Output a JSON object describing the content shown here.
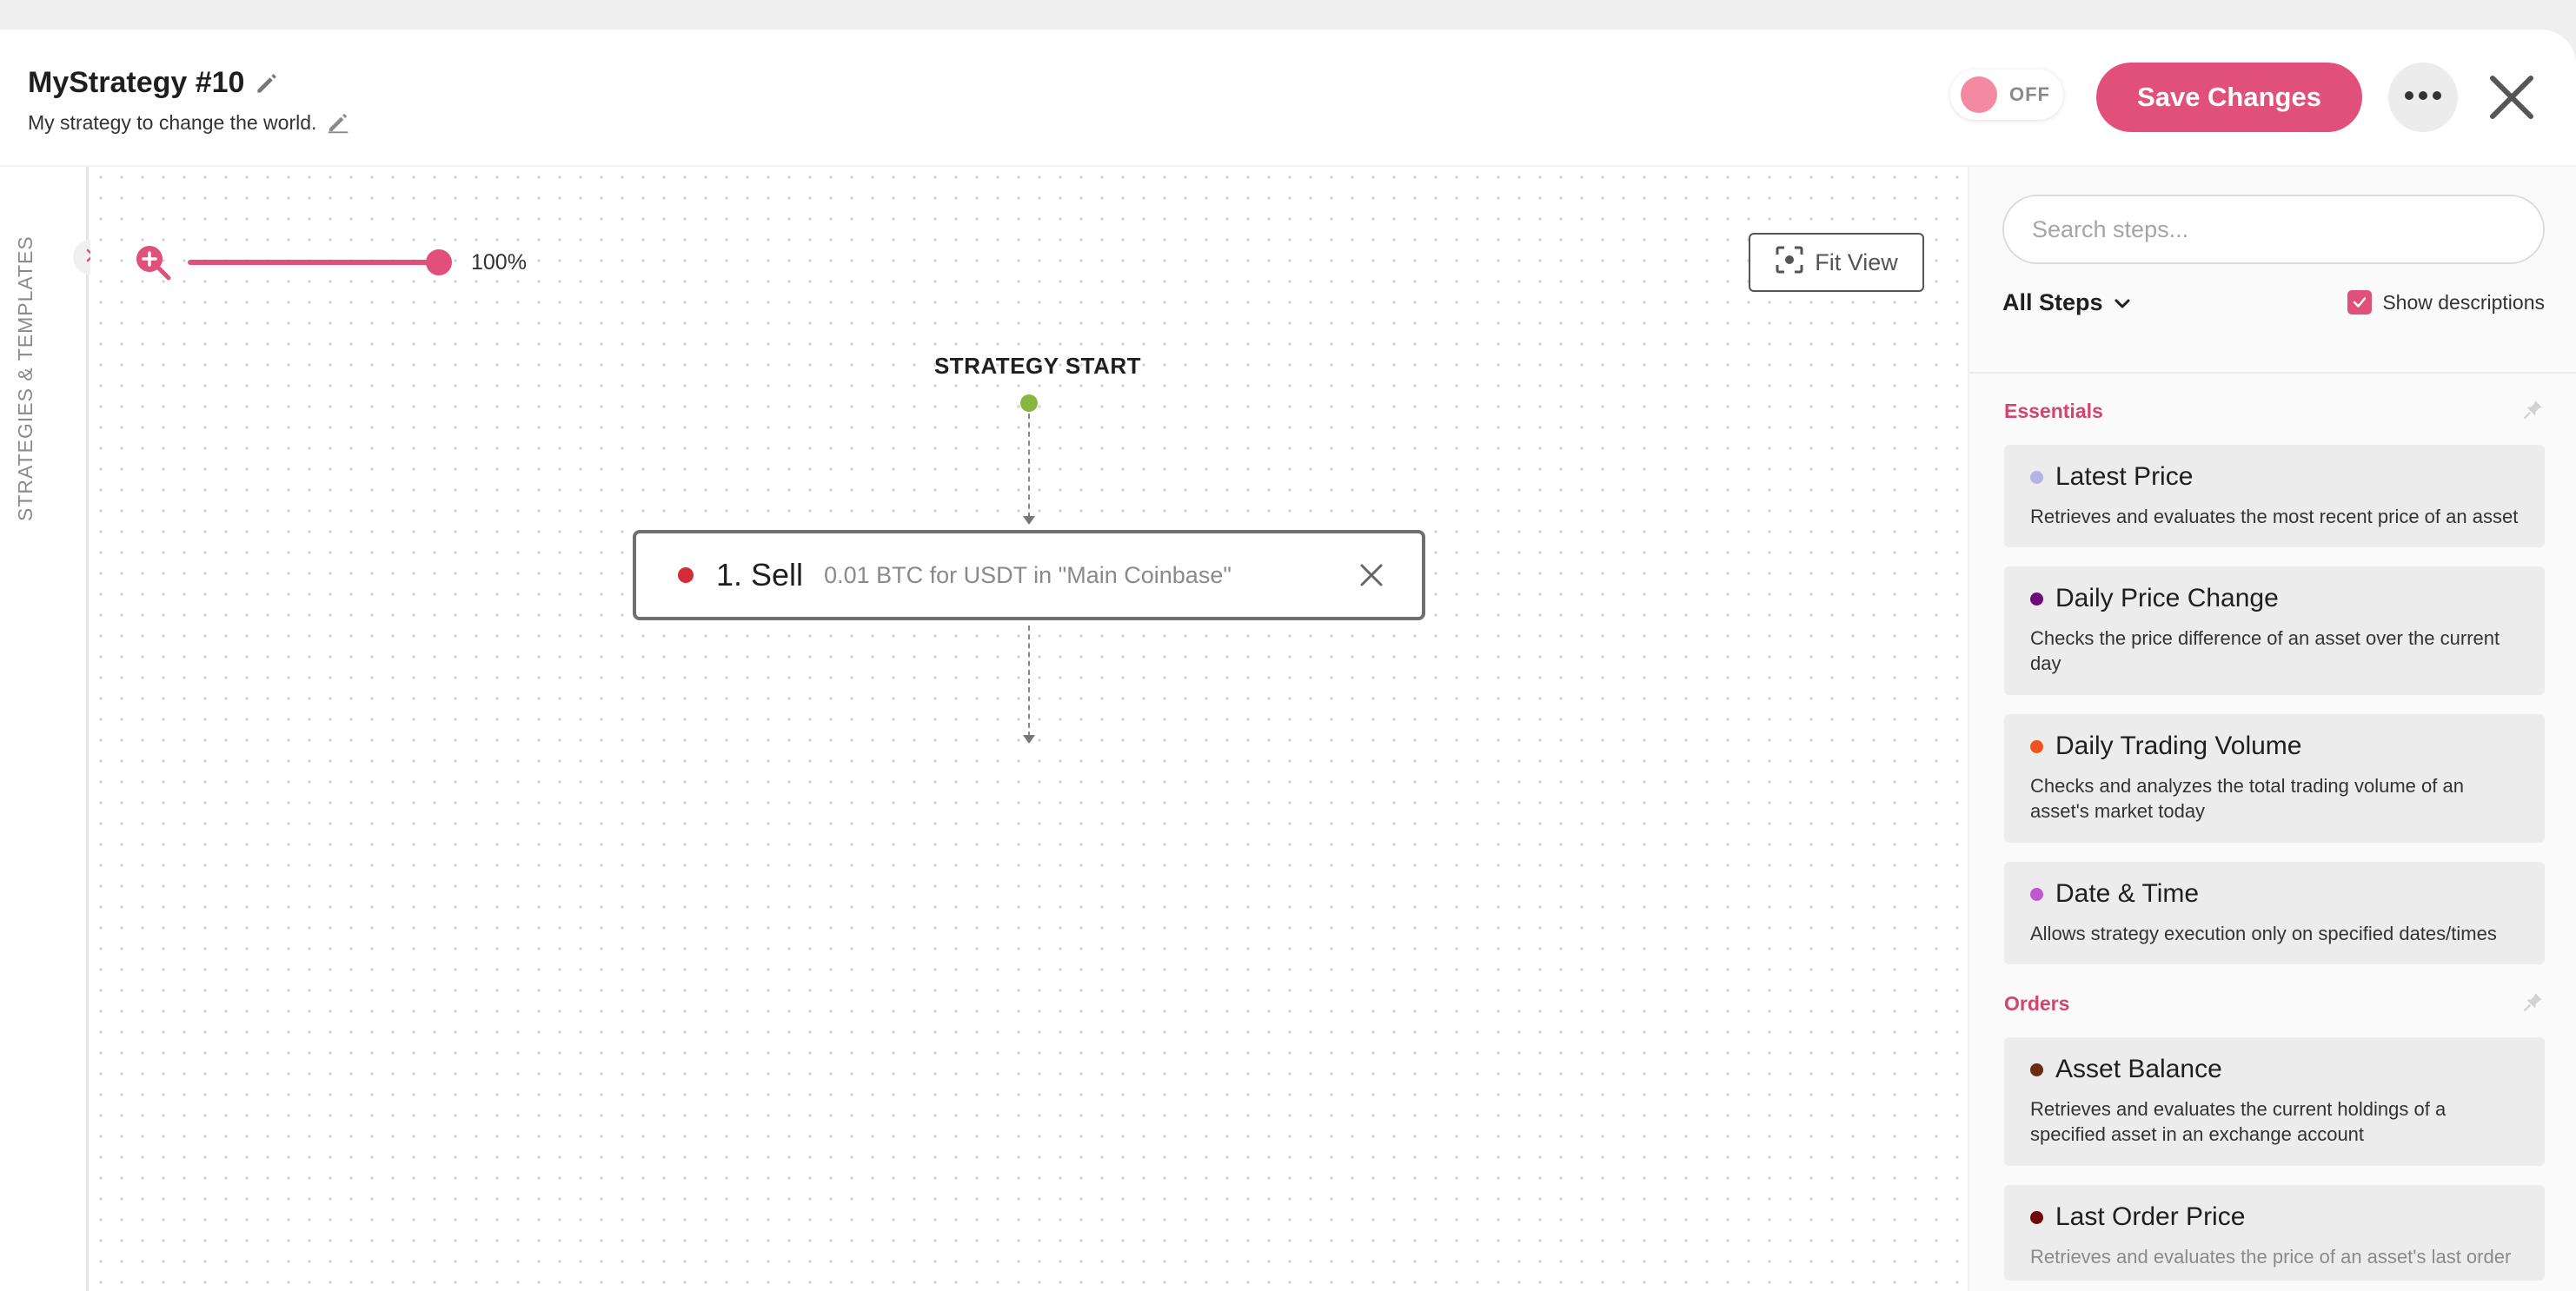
{
  "header": {
    "title": "MyStrategy #10",
    "subtitle": "My strategy to change the world.",
    "toggle_label": "OFF",
    "save_label": "Save Changes"
  },
  "sidebar": {
    "label": "STRATEGIES & TEMPLATES"
  },
  "canvas": {
    "zoom_level": "100%",
    "zoom_fraction": 1.0,
    "fit_view_label": "Fit View",
    "start_label": "STRATEGY START",
    "steps": [
      {
        "name": "1. Sell",
        "description": "0.01 BTC for USDT in \"Main Coinbase\"",
        "color": "#d42c3a"
      }
    ]
  },
  "panel": {
    "search_placeholder": "Search steps...",
    "filter_label": "All Steps",
    "show_descriptions_label": "Show descriptions",
    "show_descriptions_checked": true,
    "sections": [
      {
        "title": "Essentials",
        "items": [
          {
            "name": "Latest Price",
            "description": "Retrieves and evaluates the most recent price of an asset",
            "color": "#b3b3e6"
          },
          {
            "name": "Daily Price Change",
            "description": "Checks the price difference of an asset over the current day",
            "color": "#6b0a7a"
          },
          {
            "name": "Daily Trading Volume",
            "description": "Checks and analyzes the total trading volume of an asset's market today",
            "color": "#f0541e"
          },
          {
            "name": "Date & Time",
            "description": "Allows strategy execution only on specified dates/times",
            "color": "#c257d4"
          }
        ]
      },
      {
        "title": "Orders",
        "items": [
          {
            "name": "Asset Balance",
            "description": "Retrieves and evaluates the current holdings of a specified asset in an exchange account",
            "color": "#6b2a12"
          },
          {
            "name": "Last Order Price",
            "description": "Retrieves and evaluates the price of an asset's last order",
            "color": "#6e0a0a"
          }
        ]
      }
    ]
  },
  "colors": {
    "accent": "#e0507a",
    "section_title": "#d3456f",
    "start_dot": "#86b63c"
  }
}
